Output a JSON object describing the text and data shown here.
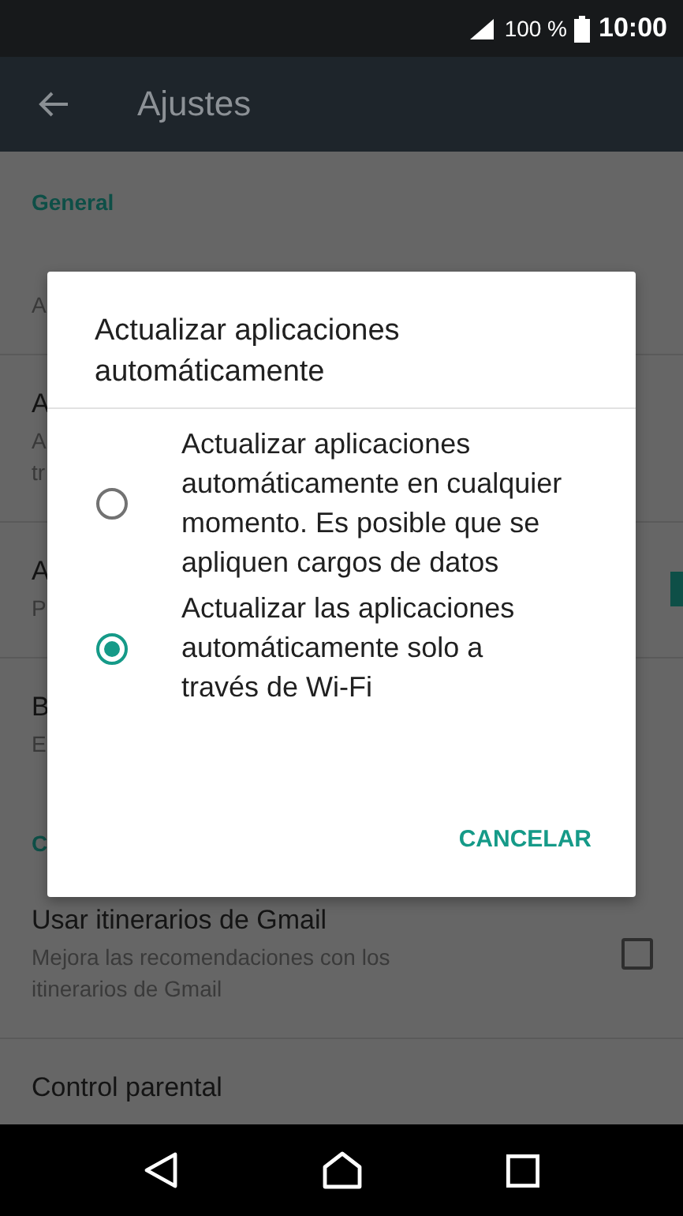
{
  "status_bar": {
    "battery": "100 %",
    "time": "10:00"
  },
  "toolbar": {
    "title": "Ajustes"
  },
  "settings": [
    {
      "kind": "header",
      "title": "General"
    },
    {
      "kind": "item",
      "subtitle": [
        "A"
      ]
    },
    {
      "kind": "item",
      "title": "A",
      "subtitle": [
        "A",
        "tr"
      ]
    },
    {
      "kind": "item",
      "title": "A",
      "subtitle": [
        "P"
      ],
      "on": true
    },
    {
      "kind": "item",
      "title": "B",
      "subtitle": [
        "E"
      ]
    },
    {
      "kind": "header",
      "title": "C"
    },
    {
      "kind": "item",
      "title": "Usar itinerarios de Gmail",
      "subtitle": [
        "Mejora las recomendaciones con los",
        "itinerarios de Gmail"
      ],
      "checked": false
    },
    {
      "kind": "item",
      "title": "Control parental"
    }
  ],
  "dialog": {
    "title": "Actualizar aplicaciones automáticamente",
    "options": [
      {
        "label": "Actualizar aplicaciones automáticamente en cualquier momento. Es posible que se apliquen cargos de datos",
        "selected": false
      },
      {
        "label": "Actualizar las aplicaciones automáticamente solo a través de Wi-Fi",
        "selected": true
      }
    ],
    "buttons": [
      "CANCELAR"
    ]
  }
}
